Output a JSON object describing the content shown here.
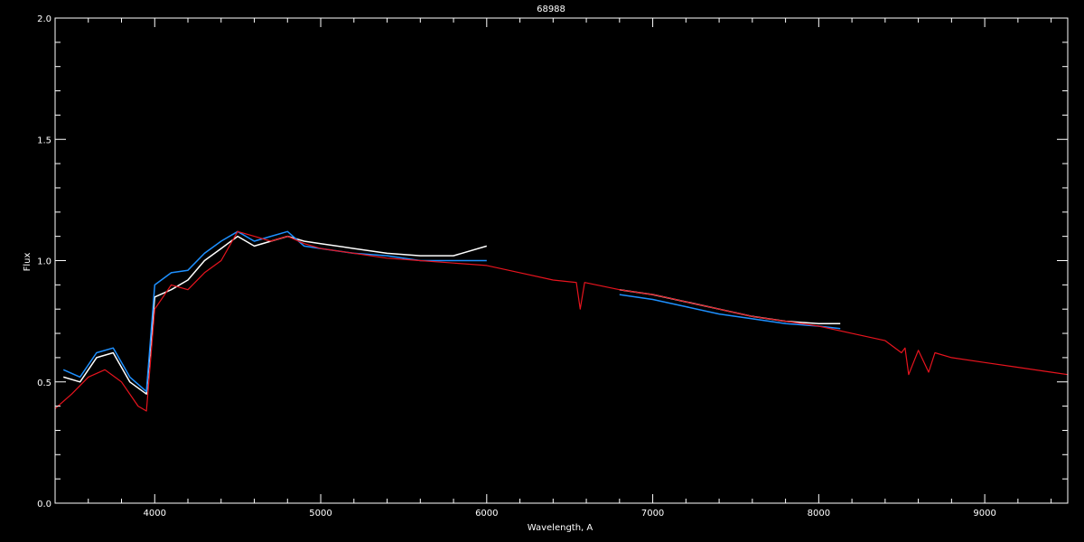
{
  "chart_data": {
    "type": "line",
    "title": "68988",
    "xlabel": "Wavelength, A",
    "ylabel": "Flux",
    "xlim": [
      3400,
      9500
    ],
    "ylim": [
      0.0,
      2.0
    ],
    "x_ticks": [
      4000,
      5000,
      6000,
      7000,
      8000,
      9000
    ],
    "x_tick_labels": [
      "4000",
      "5000",
      "6000",
      "7000",
      "8000",
      "9000"
    ],
    "y_ticks": [
      0.0,
      0.5,
      1.0,
      1.5,
      2.0
    ],
    "y_tick_labels": [
      "0.0",
      "0.5",
      "1.0",
      "1.5",
      "2.0"
    ],
    "grid": false,
    "colors": {
      "background": "#000000",
      "axes": "#ffffff",
      "observed": "#ffffff",
      "observed_alt": "#1e90ff",
      "model": "#e8141e"
    },
    "series": [
      {
        "color": "#ffffff",
        "segments": [
          {
            "x": [
              3450,
              3550,
              3650,
              3750,
              3850,
              3950,
              4000,
              4100,
              4200,
              4300,
              4400,
              4500,
              4600,
              4700,
              4800,
              4900,
              5000,
              5200,
              5400,
              5600,
              5800,
              6000
            ],
            "y": [
              0.52,
              0.5,
              0.6,
              0.62,
              0.5,
              0.45,
              0.85,
              0.88,
              0.92,
              1.0,
              1.05,
              1.1,
              1.06,
              1.08,
              1.1,
              1.08,
              1.07,
              1.05,
              1.03,
              1.02,
              1.02,
              1.06
            ]
          },
          {
            "x": [
              6800,
              7000,
              7200,
              7400,
              7600,
              7800,
              8000,
              8130
            ],
            "y": [
              0.88,
              0.86,
              0.83,
              0.8,
              0.77,
              0.75,
              0.74,
              0.74
            ]
          }
        ]
      },
      {
        "color": "#1e90ff",
        "segments": [
          {
            "x": [
              3450,
              3550,
              3650,
              3750,
              3850,
              3950,
              4000,
              4100,
              4200,
              4300,
              4400,
              4500,
              4600,
              4700,
              4800,
              4900,
              5000,
              5200,
              5400,
              5600,
              5800,
              6000
            ],
            "y": [
              0.55,
              0.52,
              0.62,
              0.64,
              0.52,
              0.46,
              0.9,
              0.95,
              0.96,
              1.03,
              1.08,
              1.12,
              1.08,
              1.1,
              1.12,
              1.06,
              1.05,
              1.03,
              1.02,
              1.0,
              1.0,
              1.0
            ]
          },
          {
            "x": [
              6800,
              7000,
              7200,
              7400,
              7600,
              7800,
              8000,
              8130
            ],
            "y": [
              0.86,
              0.84,
              0.81,
              0.78,
              0.76,
              0.74,
              0.73,
              0.72
            ]
          }
        ]
      },
      {
        "color": "#e8141e",
        "segments": [
          {
            "x": [
              3400,
              3500,
              3600,
              3700,
              3800,
              3900,
              3950,
              4000,
              4100,
              4200,
              4300,
              4400,
              4500,
              4600,
              4700,
              4800,
              4900,
              5000,
              5200,
              5400,
              5600,
              5800,
              6000,
              6200,
              6400,
              6540,
              6563,
              6590,
              6800,
              7000,
              7200,
              7400,
              7600,
              7800,
              8000,
              8200,
              8400,
              8498,
              8520,
              8542,
              8600,
              8662,
              8700,
              8800,
              9000,
              9200,
              9400,
              9500
            ],
            "y": [
              0.39,
              0.45,
              0.52,
              0.55,
              0.5,
              0.4,
              0.38,
              0.8,
              0.9,
              0.88,
              0.95,
              1.0,
              1.12,
              1.1,
              1.08,
              1.1,
              1.07,
              1.05,
              1.03,
              1.01,
              1.0,
              0.99,
              0.98,
              0.95,
              0.92,
              0.91,
              0.8,
              0.91,
              0.88,
              0.86,
              0.83,
              0.8,
              0.77,
              0.75,
              0.73,
              0.7,
              0.67,
              0.62,
              0.64,
              0.53,
              0.63,
              0.54,
              0.62,
              0.6,
              0.58,
              0.56,
              0.54,
              0.53
            ]
          }
        ]
      }
    ]
  }
}
